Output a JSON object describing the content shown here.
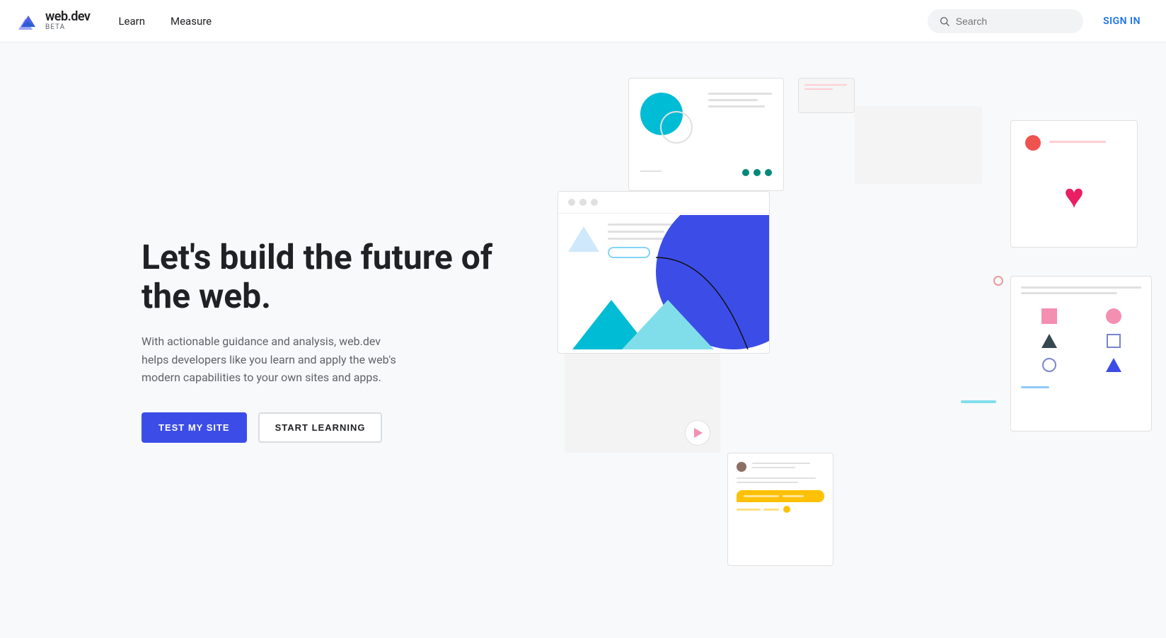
{
  "brand": {
    "logo_text": "web.dev",
    "logo_beta": "BETA",
    "logo_icon_color": "#3c4de7"
  },
  "nav": {
    "links": [
      {
        "label": "Learn",
        "id": "learn"
      },
      {
        "label": "Measure",
        "id": "measure"
      }
    ],
    "search_placeholder": "Search",
    "signin_label": "SIGN IN"
  },
  "hero": {
    "title": "Let's build the future of the web.",
    "description": "With actionable guidance and analysis, web.dev helps developers like you learn and apply the web's modern capabilities to your own sites and apps.",
    "btn_primary": "TEST MY SITE",
    "btn_secondary": "START LEARNING"
  },
  "colors": {
    "primary": "#3c4de7",
    "teal": "#00bcd4",
    "pink": "#e91e63",
    "yellow": "#ffc107",
    "light_bg": "#f8f9fa"
  }
}
